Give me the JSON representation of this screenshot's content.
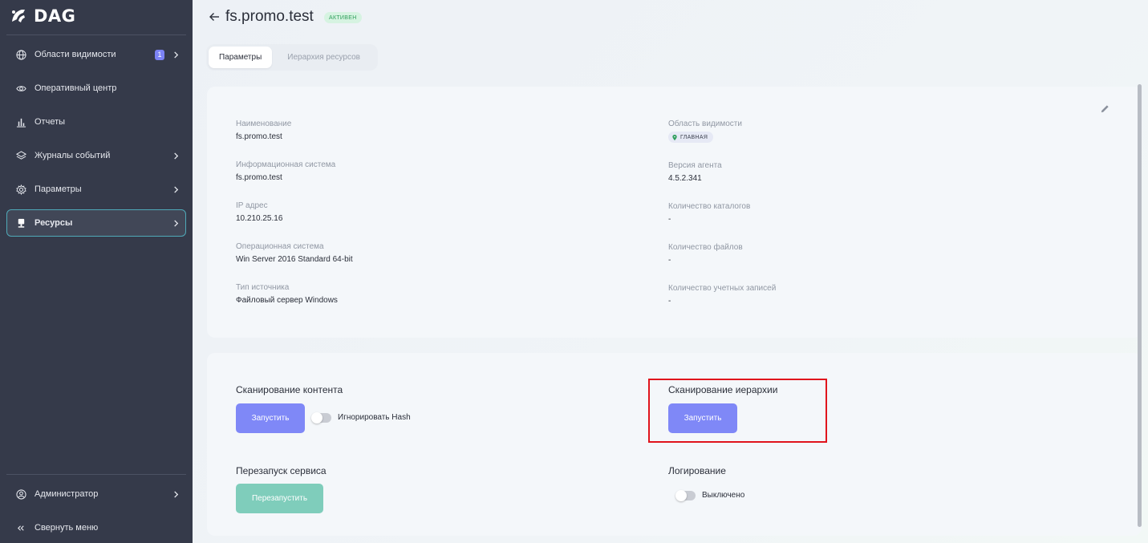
{
  "app": {
    "brand": "DAG"
  },
  "sidebar": {
    "items": [
      {
        "label": "Области видимости",
        "badge": "1",
        "icon": "globe-icon"
      },
      {
        "label": "Оперативный центр",
        "icon": "eye-icon"
      },
      {
        "label": "Отчеты",
        "icon": "chart-icon"
      },
      {
        "label": "Журналы событий",
        "icon": "layers-icon"
      },
      {
        "label": "Параметры",
        "icon": "gear-icon"
      },
      {
        "label": "Ресурсы",
        "icon": "server-icon"
      }
    ],
    "user": {
      "label": "Администратор",
      "icon": "user-icon"
    },
    "collapse": {
      "label": "Свернуть меню",
      "icon": "double-chevron-left-icon"
    }
  },
  "header": {
    "title": "fs.promo.test",
    "status": "АКТИВЕН"
  },
  "tabs": [
    {
      "label": "Параметры",
      "active": true
    },
    {
      "label": "Иерархия ресурсов",
      "active": false
    }
  ],
  "details": {
    "left": [
      {
        "label": "Наименование",
        "value": "fs.promo.test"
      },
      {
        "label": "Информационная система",
        "value": "fs.promo.test"
      },
      {
        "label": "IP адрес",
        "value": "10.210.25.16"
      },
      {
        "label": "Операционная система",
        "value": "Win Server 2016 Standard 64-bit"
      },
      {
        "label": "Тип источника",
        "value": "Файловый сервер Windows"
      }
    ],
    "right": [
      {
        "label": "Область видимости",
        "chip": "ГЛАВНАЯ"
      },
      {
        "label": "Версия агента",
        "value": "4.5.2.341"
      },
      {
        "label": "Количество каталогов",
        "value": "-"
      },
      {
        "label": "Количество файлов",
        "value": "-"
      },
      {
        "label": "Количество учетных записей",
        "value": "-"
      }
    ]
  },
  "actions": {
    "content_scan": {
      "title": "Сканирование контента",
      "button": "Запустить",
      "toggle_label": "Игнорировать Hash",
      "toggle_on": false
    },
    "hierarchy_scan": {
      "title": "Сканирование иерархии",
      "button": "Запустить"
    },
    "restart": {
      "title": "Перезапуск сервиса",
      "button": "Перезапустить"
    },
    "logging": {
      "title": "Логирование",
      "toggle_label": "Выключено",
      "toggle_on": false
    }
  },
  "colors": {
    "sidebar_bg": "#353a4a",
    "accent": "#7f88f7",
    "teal": "#7fcdbb",
    "active_border": "#4fa9b8",
    "status_green": "#2e9e5b",
    "highlight": "#e0141c"
  }
}
